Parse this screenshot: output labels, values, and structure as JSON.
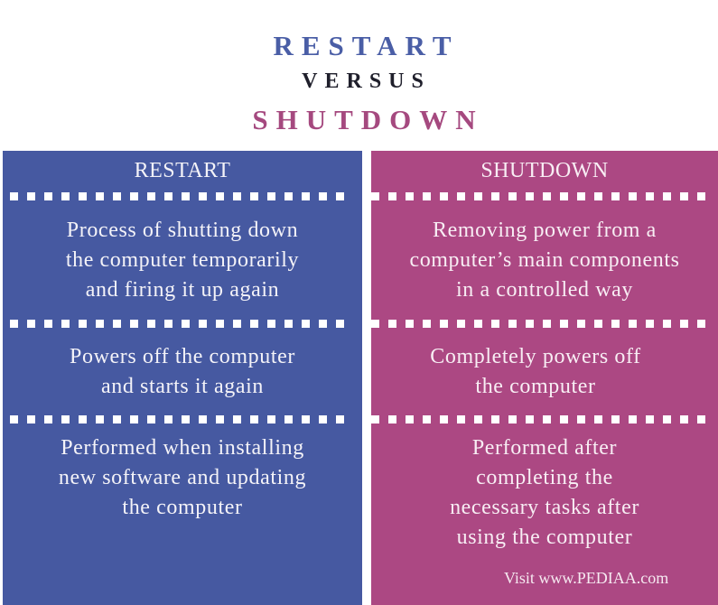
{
  "title": {
    "line1": "RESTART",
    "line2": "VERSUS",
    "line3": "SHUTDOWN"
  },
  "colors": {
    "restart_accent": "#4659a1",
    "shutdown_accent": "#ac4883",
    "versus_text": "#1f1f2b",
    "background": "#ffffff"
  },
  "columns": [
    {
      "heading": "RESTART",
      "rows": [
        [
          "Process of shutting down",
          "the computer temporarily",
          "and firing it up again"
        ],
        [
          "Powers off the computer",
          "and starts it again"
        ],
        [
          "Performed when installing",
          "new software and updating",
          "the computer"
        ]
      ]
    },
    {
      "heading": "SHUTDOWN",
      "rows": [
        [
          "Removing power from a",
          "computer’s main components",
          "in a controlled way"
        ],
        [
          "Completely powers off",
          "the computer"
        ],
        [
          "Performed after",
          "completing the",
          "necessary tasks after",
          "using the computer"
        ]
      ]
    }
  ],
  "footer": "Visit www.PEDIAA.com"
}
